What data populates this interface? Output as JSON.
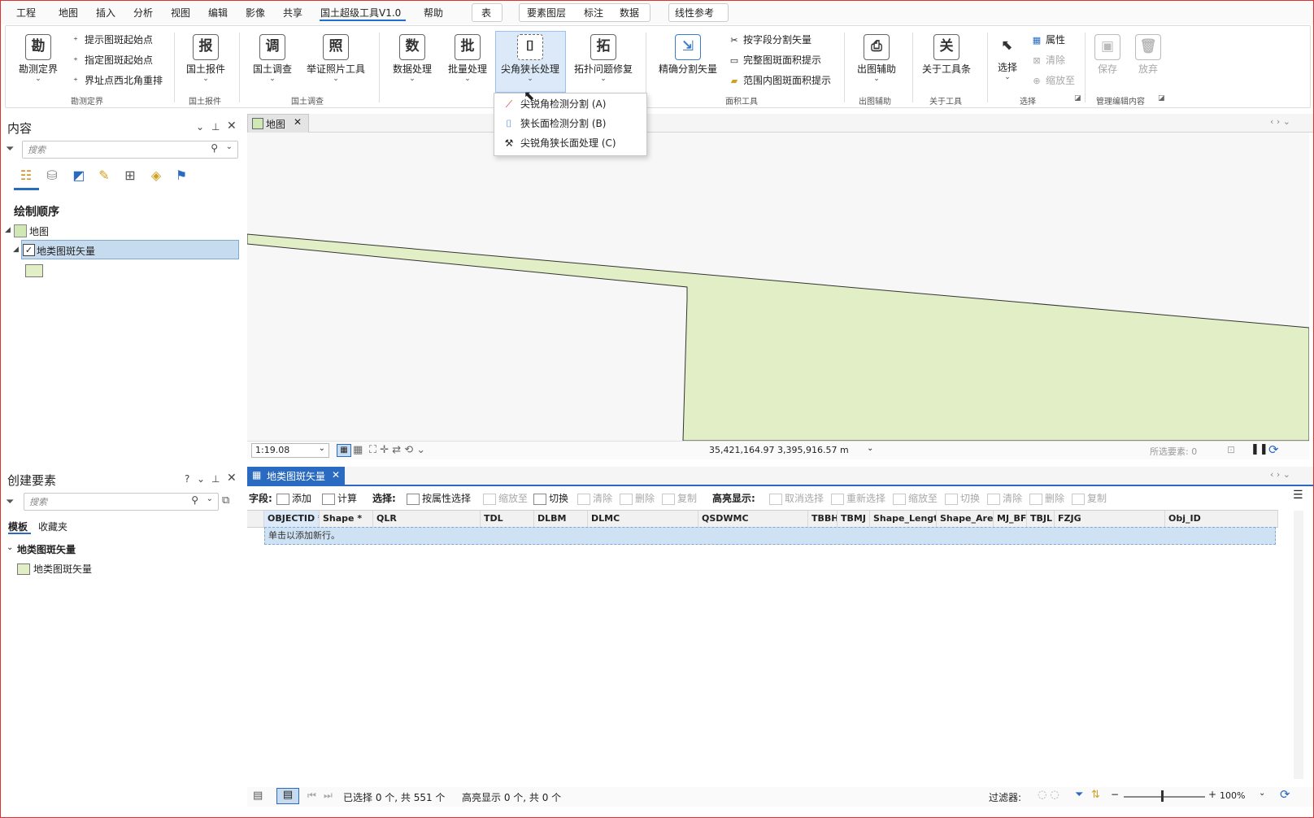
{
  "menubar": {
    "items": [
      "工程",
      "地图",
      "插入",
      "分析",
      "视图",
      "编辑",
      "影像",
      "共享",
      "国土超级工具V1.0",
      "帮助"
    ],
    "context_tabs": [
      "表",
      "要素图层",
      "标注",
      "数据",
      "线性参考"
    ]
  },
  "ribbon": {
    "survey": {
      "big": "勘测定界",
      "small": [
        "提示图斑起始点",
        "指定图斑起始点",
        "界址点西北角重排"
      ],
      "group": "勘测定界"
    },
    "report": {
      "big": "国土报件",
      "group": "国土报件"
    },
    "investigation": {
      "big1": "国土调查",
      "big2": "举证照片工具",
      "group": "国土调查"
    },
    "data": {
      "big1": "数据处理",
      "big2": "批量处理",
      "big3": "尖角狭长处理",
      "big4": "拓扑问题修复"
    },
    "area": {
      "big": "精确分割矢量",
      "small": [
        "按字段分割矢量",
        "完整图斑面积提示",
        "范围内图斑面积提示"
      ],
      "group": "面积工具"
    },
    "output": {
      "big": "出图辅助",
      "group": "出图辅助"
    },
    "about": {
      "big": "关于工具条",
      "group": "关于工具"
    },
    "select": {
      "big": "选择",
      "small": [
        "属性",
        "清除",
        "缩放至"
      ],
      "group": "选择"
    },
    "edit": {
      "save": "保存",
      "discard": "放弃",
      "group": "管理编辑内容"
    }
  },
  "dropdown": {
    "items": [
      "尖锐角检测分割 (A)",
      "狭长面检测分割 (B)",
      "尖锐角狭长面处理 (C)"
    ]
  },
  "contents": {
    "title": "内容",
    "search_placeholder": "搜索",
    "drawing_order": "绘制顺序",
    "map_node": "地图",
    "layer": "地类图斑矢量"
  },
  "create": {
    "title": "创建要素",
    "ctrl": "?",
    "search_placeholder": "搜索",
    "tabs": [
      "模板",
      "收藏夹"
    ],
    "group": "地类图斑矢量",
    "template": "地类图斑矢量"
  },
  "map": {
    "tab": "地图",
    "scale": "1:19.08",
    "coords": "35,421,164.97 3,395,916.57 m",
    "selected": "所选要素: 0",
    "colors": {
      "polygon": "#e2efc6",
      "outline": "#333333"
    }
  },
  "table": {
    "tab": "地类图斑矢量",
    "toolbar": {
      "field": "字段:",
      "add": "添加",
      "calc": "计算",
      "select": "选择:",
      "by_attr": "按属性选择",
      "zoom": "缩放至",
      "switch": "切换",
      "clear": "清除",
      "delete": "删除",
      "copy": "复制",
      "highlight": "高亮显示:",
      "unselect": "取消选择",
      "reselect": "重新选择",
      "zoom2": "缩放至",
      "switch2": "切换",
      "clear2": "清除",
      "delete2": "删除",
      "copy2": "复制"
    },
    "columns": [
      "OBJECTID *",
      "Shape *",
      "QLR",
      "TDL",
      "DLBM",
      "DLMC",
      "QSDWMC",
      "TBBH",
      "TBMJ",
      "Shape_Length",
      "Shape_Area",
      "MJ_BF",
      "TBJL",
      "FZJG",
      "Obj_ID"
    ],
    "new_row": "单击以添加新行。",
    "status": "已选择 0 个, 共 551 个",
    "highlight_status": "高亮显示 0 个, 共 0 个",
    "filter": "过滤器:",
    "zoom": "100%"
  }
}
